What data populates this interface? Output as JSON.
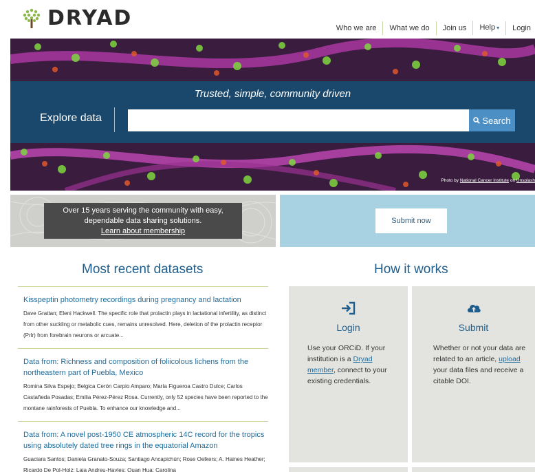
{
  "header": {
    "logo_text": "DRYAD",
    "nav": [
      {
        "label": "Who we are"
      },
      {
        "label": "What we do"
      },
      {
        "label": "Join us"
      },
      {
        "label": "Help",
        "caret": "▾"
      },
      {
        "label": "Login"
      }
    ]
  },
  "hero": {
    "tagline": "Trusted, simple, community driven",
    "explore_label": "Explore data",
    "search_value": "",
    "search_button": "Search",
    "photo_credit_prefix": "Photo by ",
    "photo_credit_author": "National Cancer Institute",
    "photo_credit_mid": " on ",
    "photo_credit_site": "Unsplash"
  },
  "promo": {
    "line1": "Over 15 years serving the community with easy,",
    "line2": "dependable data sharing solutions.",
    "link": "Learn about membership",
    "submit_button": "Submit now"
  },
  "recent": {
    "title": "Most recent datasets",
    "items": [
      {
        "title": "Kisspeptin photometry recordings during pregnancy and lactation",
        "desc": "Dave Grattan; Eleni Hackwell. The specific role that prolactin plays in lactational infertility, as distinct from other suckling or metabolic cues, remains unresolved. Here, deletion of the prolactin receptor (Prlr) from forebrain neurons or arcuate..."
      },
      {
        "title": "Data from: Richness and composition of foliicolous lichens from the northeastern part of Puebla, Mexico",
        "desc": "Romina Silva Espejo; Belgica Cerón Carpio Amparo; María Figueroa Castro Dulce; Carlos Castañeda Posadas; Emilia Pérez-Pérez Rosa. Currently, only 52 species have been reported to the montane rainforests of Puebla. To enhance our knowledge and..."
      },
      {
        "title": "Data from: A novel post-1950 CE atmospheric 14C record for the tropics using absolutely dated tree rings in the equatorial Amazon",
        "desc": "Guaciara Santos; Daniela Granato-Souza; Santiago Ancapichún; Rose Oelkers; A. Haines Heather; Ricardo De Pol-Holz; Laia Andreu-Hayles; Quan Hua; Carolina"
      }
    ]
  },
  "how": {
    "title": "How it works",
    "login": {
      "title": "Login",
      "t1": "Use your ORCiD. If your institution is a ",
      "link": "Dryad member",
      "t2": ", connect to your existing credentials."
    },
    "submit": {
      "title": "Submit",
      "t1": "Whether or not your data are related to an article, ",
      "link": "upload",
      "t2": " your data files and receive a citable DOI."
    }
  },
  "colors": {
    "brand_blue": "#1f5e8c",
    "link_blue": "#1f6c9c",
    "search_button": "#4b8fc4",
    "band": "#164e73",
    "promo_right": "#a8d2e2",
    "logo_green": "#8cb84a"
  },
  "icons": {
    "logo": "tree-logo-icon",
    "search": "search-icon",
    "login": "sign-in-icon",
    "submit": "cloud-upload-icon"
  }
}
